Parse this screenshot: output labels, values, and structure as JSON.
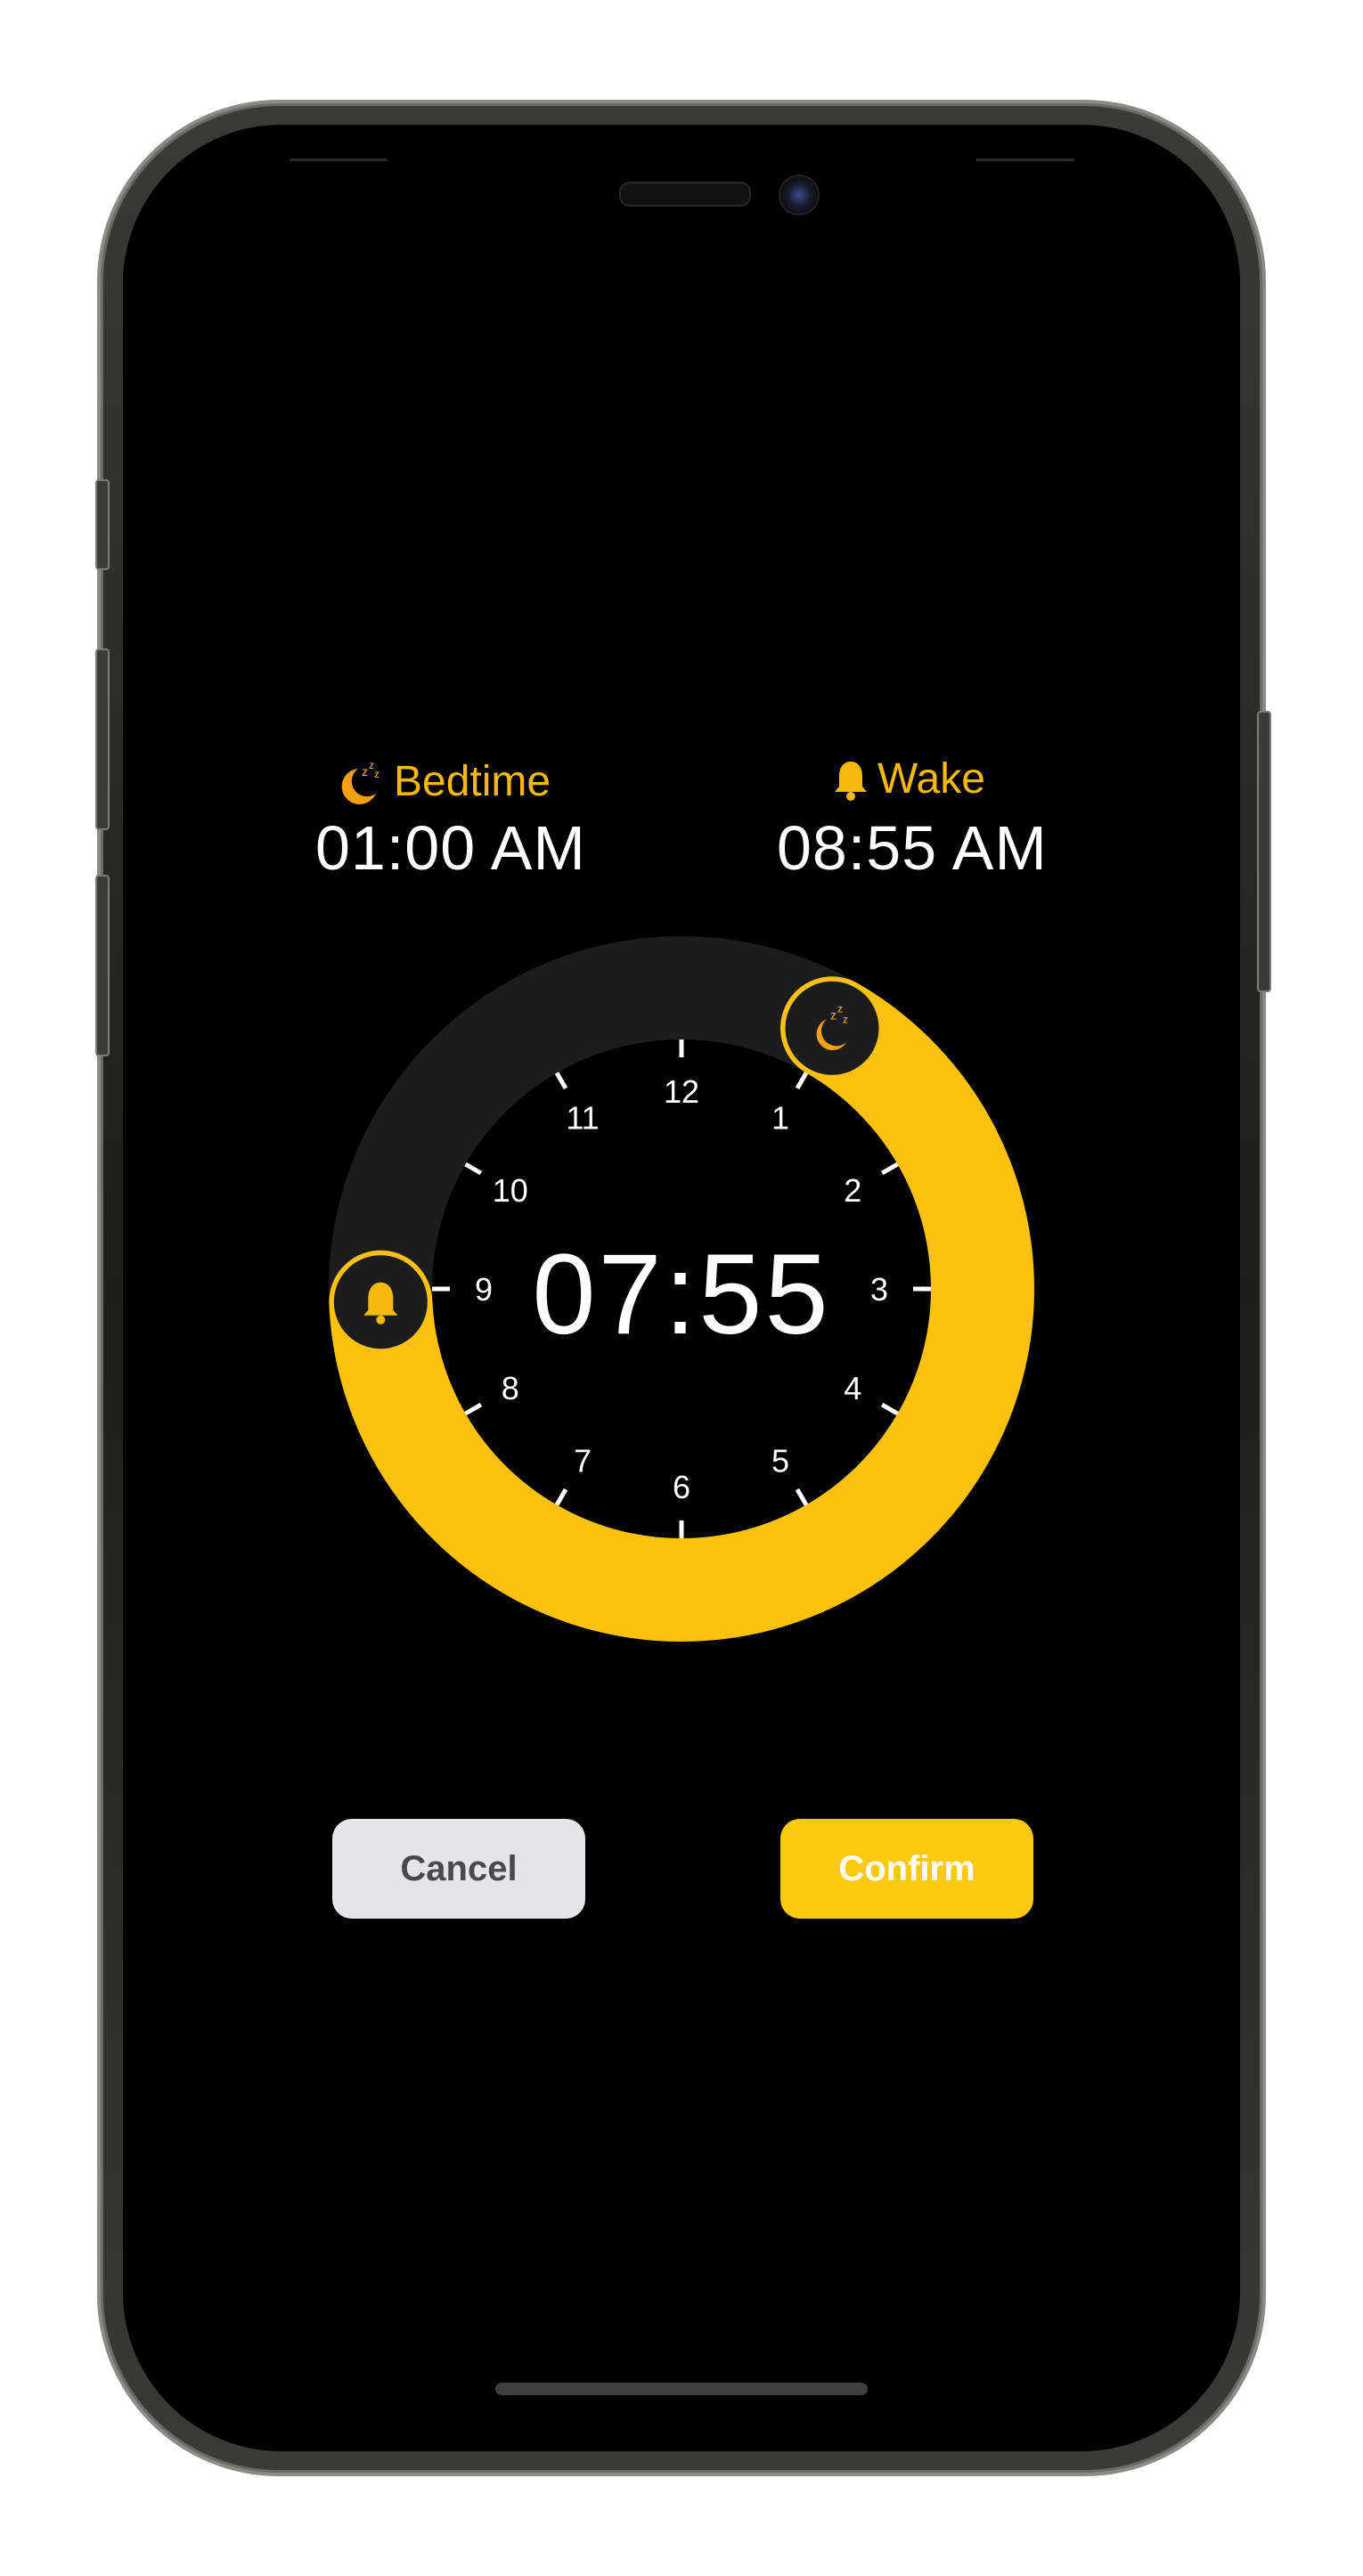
{
  "bedtime": {
    "label": "Bedtime",
    "time": "01:00 AM",
    "icon": "moon-zzz-icon",
    "hour": 1.0
  },
  "wake": {
    "label": "Wake",
    "time": "08:55 AM",
    "icon": "bell-icon",
    "hour": 8.9167
  },
  "dial": {
    "duration": "07:55",
    "hour_labels": [
      "12",
      "1",
      "2",
      "3",
      "4",
      "5",
      "6",
      "7",
      "8",
      "9",
      "10",
      "11"
    ]
  },
  "buttons": {
    "cancel": "Cancel",
    "confirm": "Confirm"
  },
  "colors": {
    "accent": "#fbc10f",
    "label_orange": "#f5b80e",
    "track": "#1c1c1c",
    "background": "#000000",
    "cancel_bg": "#e6e6ea"
  }
}
